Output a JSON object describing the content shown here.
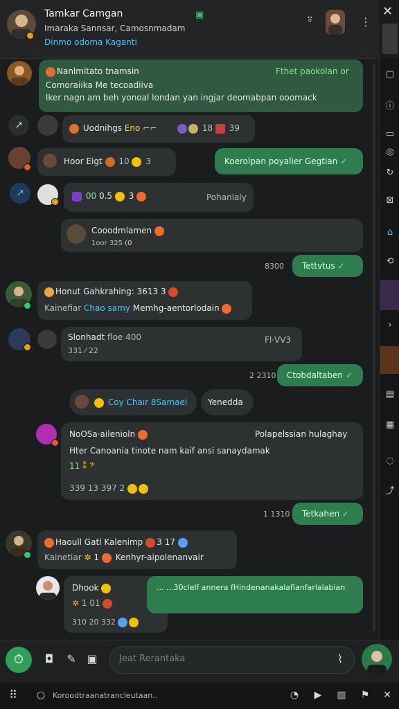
{
  "header": {
    "title": "Tamkar Camgan",
    "subtitle": "Imaraka Sannsar, Camosnmadam",
    "subtitle2": "Dinmo odoma Kaganti"
  },
  "messages": [
    {
      "type": "in",
      "title": "Nanlmitato tnamsin",
      "status": "Fthet paokolan or",
      "line1": "Comoraiika Me tecoadiiva",
      "line2": "lker nagn am beh yonoal londan yan ingjar deomabpan ooomack"
    },
    {
      "type": "in",
      "label": "Uodnihgs",
      "label2": "Eno",
      "count1": "18",
      "count2": "39"
    },
    {
      "type": "in",
      "label": "Hoor Eigt",
      "count1": "10",
      "count2": "3"
    },
    {
      "type": "out",
      "text": "Koerolpan poyalier Gegtian"
    },
    {
      "type": "in",
      "label": "0.5",
      "count": "3",
      "status": "Pohanlaly"
    },
    {
      "type": "in",
      "label": "Cooodmlamen",
      "meta": "1oor 325"
    },
    {
      "type": "out",
      "time": "8300",
      "text": "Tettvtus"
    },
    {
      "type": "in",
      "title": "Honut Gahkrahing:",
      "counts": "3613 3",
      "sub": "Kainefiar",
      "sub2": "Chao samy",
      "sub3": "Memhg-aentorlodain"
    },
    {
      "type": "in",
      "title": "Slonhadt",
      "meta": "floe 400",
      "right": "Fl·VV3",
      "line2": "331",
      "line2b": "22"
    },
    {
      "type": "out",
      "time": "2 2310",
      "text": "Ctobdaltaben"
    },
    {
      "type": "in",
      "chip1": "Coy Chaır 8Samaei",
      "chip2": "Yenedda"
    },
    {
      "type": "in",
      "title": "NoOSa·ailenioln",
      "status": "Polapelssian hulaghay",
      "line1": "Hter Canoania tinote nam kaif ansi sanaydamak",
      "line2": "11",
      "line3": "339 13 397 2"
    },
    {
      "type": "out",
      "time": "1 1310",
      "text": "Tetkahen"
    },
    {
      "type": "in",
      "title": "Haoull Gatl Kalenimp",
      "counts": "3 17",
      "sub": "Kainetiar",
      "sub2": "1",
      "sub3": "Kenhyr-aipolenanvair"
    },
    {
      "type": "in",
      "title": "Dhook",
      "line2": "1  01",
      "line3": "310 20 332"
    },
    {
      "type": "out",
      "text": "... ...30clelf annera fHindenanakalaflanfarlalabian"
    }
  ],
  "composer": {
    "placeholder": "Jeat Rerantaka"
  },
  "bottom_bar": {
    "search_text": "Koroodtraanatrancleutaan.."
  },
  "colors": {
    "accent_green": "#2e7d4f",
    "incoming_bubble": "#2e3132",
    "link_blue": "#4fc3f7"
  }
}
